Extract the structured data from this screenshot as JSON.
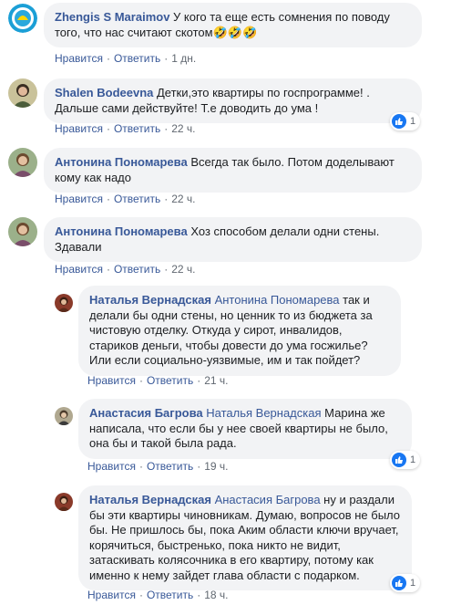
{
  "theme": {
    "link_color": "#385898",
    "bubble_bg": "#f2f3f5",
    "meta_color": "#606770",
    "like_color": "#1877f2"
  },
  "actions": {
    "like": "Нравится",
    "reply": "Ответить",
    "separator": "·"
  },
  "comments": [
    {
      "author": "Zhengis S Maraimov",
      "mention": "",
      "text": "У кого та еще есть сомнения по поводу того, что нас считают скотом🤣🤣🤣",
      "time": "1 дн.",
      "avatar_icon": "org-logo-icon",
      "reactions": null
    },
    {
      "author": "Shalen Bodeevna",
      "mention": "",
      "text": "Детки,это квартиры по госпрограмме! . Дальше сами действуйте! Т.е доводить до ума !",
      "time": "22 ч.",
      "avatar_icon": "user-photo-icon",
      "reactions": "1"
    },
    {
      "author": "Антонина Пономарева",
      "mention": "",
      "text": "Всегда так было. Потом доделывают кому как надо",
      "time": "22 ч.",
      "avatar_icon": "user-photo-icon",
      "reactions": null
    },
    {
      "author": "Антонина Пономарева",
      "mention": "",
      "text": "Хоз способом делали одни стены. Здавали",
      "time": "22 ч.",
      "avatar_icon": "user-photo-icon",
      "reactions": null
    },
    {
      "author": "Наталья Вернадская",
      "mention": "Антонина Пономарева",
      "text": "так и делали бы одни стены, но ценник то из бюджета за чистовую отделку. Откуда у сирот, инвалидов, стариков деньги, чтобы довести до ума госжилье? Или если социально-уязвимые, им и так пойдет?",
      "time": "21 ч.",
      "avatar_icon": "user-photo-icon",
      "reactions": null
    },
    {
      "author": "Анастасия Багрова",
      "mention": "Наталья Вернадская",
      "text": "Марина же написала, что если бы у нее своей квартиры не было, она бы и такой была рада.",
      "time": "19 ч.",
      "avatar_icon": "user-photo-icon",
      "reactions": "1"
    },
    {
      "author": "Наталья Вернадская",
      "mention": "Анастасия Багрова",
      "text": "ну и раздали бы эти квартиры чиновникам. Думаю, вопросов не было бы. Не пришлось бы, пока Аким области ключи вручает, корячиться, быстренько, пока никто не видит, затаскивать колясочника в его квартиру, потому как именно к нему зайдет глава области с подарком.",
      "time": "18 ч.",
      "avatar_icon": "user-photo-icon",
      "reactions": "1"
    }
  ]
}
